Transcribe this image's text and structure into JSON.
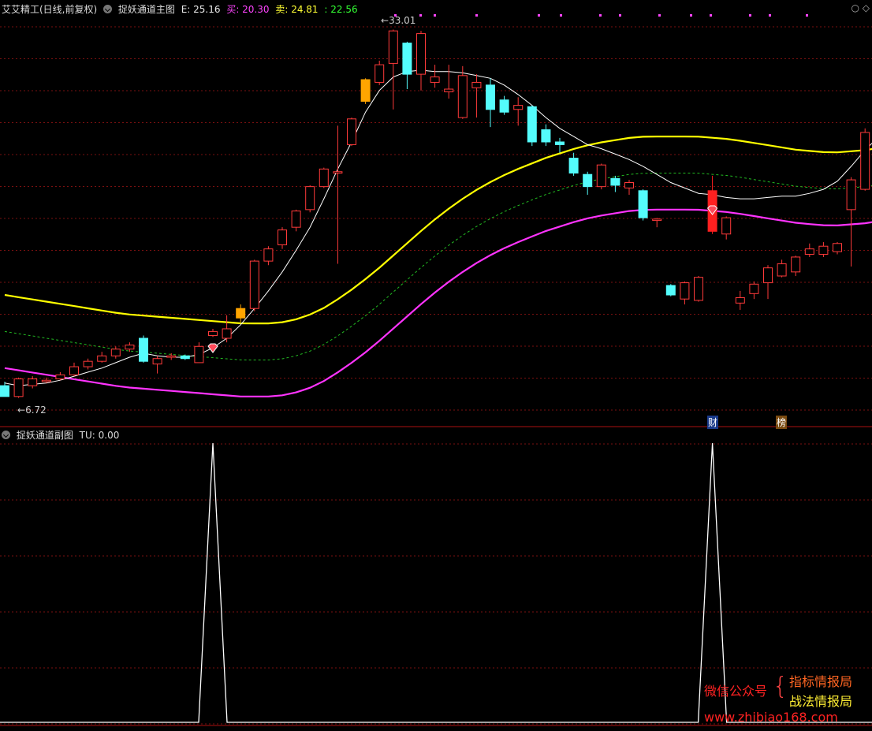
{
  "main_panel": {
    "stock_label": "艾艾精工(日线,前复权)",
    "indicator_name": "捉妖通道主图",
    "e_label": "E: 25.16",
    "buy_label": "买: 20.30",
    "sell_label": "卖: 24.81",
    "extra_value": ": 22.56",
    "high_marker": "33.01",
    "low_marker": "6.72",
    "tag_cai": "财",
    "tag_bang": "榜"
  },
  "sub_panel": {
    "indicator_name": "捉妖通道副图",
    "tu_label": "TU: 0.00"
  },
  "corner_icons": [
    "circle-icon",
    "diamond-icon"
  ],
  "watermark": {
    "left": "微信公众号",
    "right_top": "指标情报局",
    "right_bottom": "战法情报局",
    "url": "www.zhibiao168.com"
  },
  "colors": {
    "up": "#ff3a3a",
    "down": "#54fcfc",
    "highlight_up": "#ffa500",
    "signal": "#ff2020",
    "yellow_line": "#ffff00",
    "green_dashed": "#22bb22",
    "magenta_line": "#ff33ff",
    "white_line": "#ffffff",
    "grid": "#7a1010"
  },
  "chart_data": [
    {
      "type": "candlestick",
      "ylim": [
        5.0,
        34.0
      ],
      "candles": [
        [
          6.8,
          6.0,
          7.1,
          6.0
        ],
        [
          6.0,
          7.3,
          7.4,
          5.9
        ],
        [
          6.8,
          7.3,
          7.5,
          6.6
        ],
        [
          7.1,
          7.2,
          7.4,
          7.0
        ],
        [
          7.3,
          7.6,
          7.8,
          7.2
        ],
        [
          7.6,
          8.2,
          8.5,
          7.5
        ],
        [
          8.2,
          8.6,
          8.8,
          8.0
        ],
        [
          8.6,
          9.0,
          9.3,
          8.5
        ],
        [
          9.0,
          9.5,
          9.7,
          8.8
        ],
        [
          9.5,
          9.8,
          10.0,
          9.3
        ],
        [
          10.3,
          8.6,
          10.5,
          8.5
        ],
        [
          8.4,
          8.8,
          9.0,
          7.7
        ],
        [
          8.9,
          9.0,
          9.2,
          8.7
        ],
        [
          9.0,
          8.8,
          9.1,
          8.7
        ],
        [
          8.5,
          9.7,
          10.0,
          8.5
        ],
        [
          10.5,
          10.8,
          11.0,
          10.4
        ],
        [
          10.3,
          11.0,
          12.0,
          10.0
        ],
        [
          11.8,
          12.5,
          12.8,
          11.5
        ],
        [
          12.5,
          16.0,
          16.1,
          12.3
        ],
        [
          16.0,
          16.9,
          17.1,
          15.7
        ],
        [
          17.2,
          18.3,
          18.5,
          16.9
        ],
        [
          18.5,
          19.7,
          19.8,
          18.2
        ],
        [
          19.8,
          21.5,
          21.6,
          19.6
        ],
        [
          21.5,
          22.8,
          22.9,
          21.4
        ],
        [
          22.5,
          22.6,
          26.0,
          15.8
        ],
        [
          24.6,
          26.5,
          26.6,
          24.5
        ],
        [
          27.8,
          29.4,
          29.5,
          27.6
        ],
        [
          29.2,
          30.5,
          30.8,
          29.0
        ],
        [
          30.6,
          33.0,
          33.1,
          27.2
        ],
        [
          32.1,
          29.8,
          32.2,
          28.7
        ],
        [
          29.8,
          32.8,
          33.0,
          28.6
        ],
        [
          29.2,
          29.6,
          30.5,
          28.8
        ],
        [
          28.5,
          28.7,
          30.5,
          28.0
        ],
        [
          26.6,
          29.7,
          30.4,
          26.5
        ],
        [
          28.8,
          29.2,
          29.8,
          26.6
        ],
        [
          29.0,
          27.2,
          29.5,
          25.9
        ],
        [
          27.9,
          27.0,
          28.2,
          26.8
        ],
        [
          27.2,
          27.5,
          28.1,
          26.0
        ],
        [
          27.4,
          24.8,
          27.5,
          24.5
        ],
        [
          25.7,
          24.8,
          26.1,
          24.5
        ],
        [
          24.8,
          24.6,
          25.1,
          24.0
        ],
        [
          23.6,
          22.5,
          24.0,
          22.3
        ],
        [
          22.4,
          21.5,
          22.6,
          20.9
        ],
        [
          21.5,
          23.1,
          23.2,
          21.3
        ],
        [
          22.1,
          21.6,
          22.3,
          21.1
        ],
        [
          21.4,
          21.8,
          22.0,
          20.9
        ],
        [
          21.2,
          19.2,
          21.3,
          19.0
        ],
        [
          19.0,
          19.1,
          19.2,
          18.5
        ],
        [
          14.2,
          13.5,
          14.3,
          13.4
        ],
        [
          13.2,
          14.4,
          14.5,
          12.8
        ],
        [
          13.1,
          14.8,
          14.9,
          13.0
        ],
        [
          21.2,
          18.2,
          22.3,
          18.0
        ],
        [
          18.0,
          19.2,
          19.3,
          17.6
        ],
        [
          12.9,
          13.3,
          13.8,
          12.4
        ],
        [
          13.6,
          14.3,
          14.5,
          13.2
        ],
        [
          14.4,
          15.5,
          15.7,
          13.2
        ],
        [
          14.9,
          15.8,
          16.1,
          14.8
        ],
        [
          15.2,
          16.3,
          16.4,
          14.9
        ],
        [
          16.5,
          16.9,
          17.3,
          16.3
        ],
        [
          16.5,
          17.1,
          17.4,
          16.3
        ],
        [
          16.7,
          17.3,
          17.4,
          16.5
        ],
        [
          19.8,
          22.0,
          22.2,
          15.6
        ],
        [
          21.3,
          25.5,
          25.8,
          21.2
        ],
        [
          25.5,
          29.8,
          29.9,
          25.3
        ],
        [
          28.7,
          27.5,
          31.0,
          24.8
        ],
        [
          29.1,
          27.6,
          29.5,
          25.5
        ],
        [
          25.1,
          26.9,
          28.5,
          24.9
        ],
        [
          24.6,
          28.5,
          28.9,
          24.5
        ],
        [
          29.5,
          28.0,
          30.3,
          27.8
        ],
        [
          28.8,
          26.3,
          29.0,
          25.0
        ],
        [
          25.4,
          23.8,
          25.6,
          23.3
        ],
        [
          23.8,
          25.7,
          26.2,
          23.6
        ],
        [
          25.9,
          25.0,
          26.1,
          24.8
        ],
        [
          24.7,
          25.1,
          25.4,
          24.4
        ]
      ],
      "ma_white": [
        7.0,
        6.8,
        6.9,
        7.0,
        7.2,
        7.5,
        7.8,
        8.1,
        8.5,
        8.9,
        9.2,
        9.0,
        8.9,
        8.9,
        9.1,
        9.6,
        10.3,
        11.3,
        12.5,
        13.8,
        15.2,
        16.8,
        18.5,
        20.6,
        22.8,
        24.8,
        27.0,
        28.6,
        29.6,
        30.0,
        30.1,
        30.0,
        30.0,
        29.9,
        29.7,
        29.5,
        29.0,
        28.3,
        27.5,
        26.6,
        25.8,
        25.2,
        24.6,
        24.3,
        23.9,
        23.5,
        23.0,
        22.4,
        21.8,
        21.4,
        21.0,
        20.9,
        20.7,
        20.6,
        20.6,
        20.7,
        20.8,
        20.8,
        21.0,
        21.3,
        21.9,
        23.0,
        24.2,
        25.2,
        26.0,
        26.4,
        26.6,
        26.4,
        26.2,
        26.1,
        25.7,
        25.4,
        25.2,
        25.1,
        25.0,
        24.8
      ],
      "line_yellow": [
        13.5,
        13.3,
        13.1,
        12.9,
        12.7,
        12.5,
        12.3,
        12.1,
        12.0,
        11.9,
        11.8,
        11.7,
        11.6,
        11.5,
        11.4,
        11.4,
        11.4,
        11.6,
        12.0,
        12.6,
        13.4,
        14.3,
        15.3,
        16.4,
        17.5,
        18.6,
        19.6,
        20.5,
        21.3,
        22.0,
        22.6,
        23.1,
        23.6,
        24.0,
        24.4,
        24.7,
        24.9,
        25.1,
        25.2,
        25.2,
        25.2,
        25.2,
        25.1,
        25.0,
        24.8,
        24.6,
        24.4,
        24.2,
        24.1,
        24.0,
        24.1,
        24.2,
        24.4,
        24.6,
        24.8,
        25.0,
        25.2,
        25.3,
        25.4,
        25.6,
        25.8
      ]
    },
    {
      "type": "line",
      "name": "TU",
      "ylim": [
        0,
        1
      ],
      "spikes_at_candle_index": [
        15,
        51
      ],
      "baseline": 0,
      "peak": 1
    }
  ]
}
